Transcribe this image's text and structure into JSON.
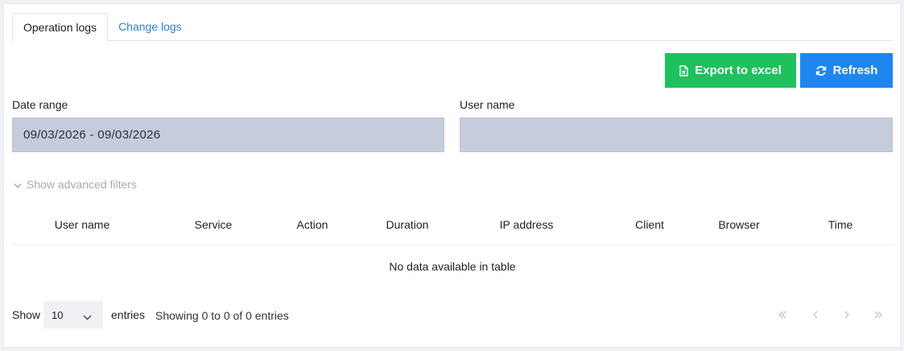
{
  "tabs": [
    {
      "label": "Operation logs",
      "active": true
    },
    {
      "label": "Change logs",
      "active": false
    }
  ],
  "toolbar": {
    "export_label": "Export to excel",
    "refresh_label": "Refresh"
  },
  "filters": {
    "date_range_label": "Date range",
    "date_range_value": "09/03/2026 - 09/03/2026",
    "user_name_label": "User name",
    "user_name_value": "",
    "advanced_label": "Show advanced filters"
  },
  "table": {
    "columns": [
      "User name",
      "Service",
      "Action",
      "Duration",
      "IP address",
      "Client",
      "Browser",
      "Time"
    ],
    "empty_message": "No data available in table"
  },
  "footer": {
    "show_label": "Show",
    "page_size": "10",
    "entries_label": "entries",
    "info": "Showing 0 to 0 of 0 entries"
  },
  "colors": {
    "export": "#1ec15d",
    "refresh": "#1f86f0",
    "input_bg": "#c6ccdb",
    "link": "#2f7fd0"
  },
  "icons": {
    "export": "excel-file-icon",
    "refresh": "refresh-icon",
    "advanced": "chevron-down-icon",
    "pager": [
      "double-chevron-left-icon",
      "chevron-left-icon",
      "chevron-right-icon",
      "double-chevron-right-icon"
    ]
  }
}
